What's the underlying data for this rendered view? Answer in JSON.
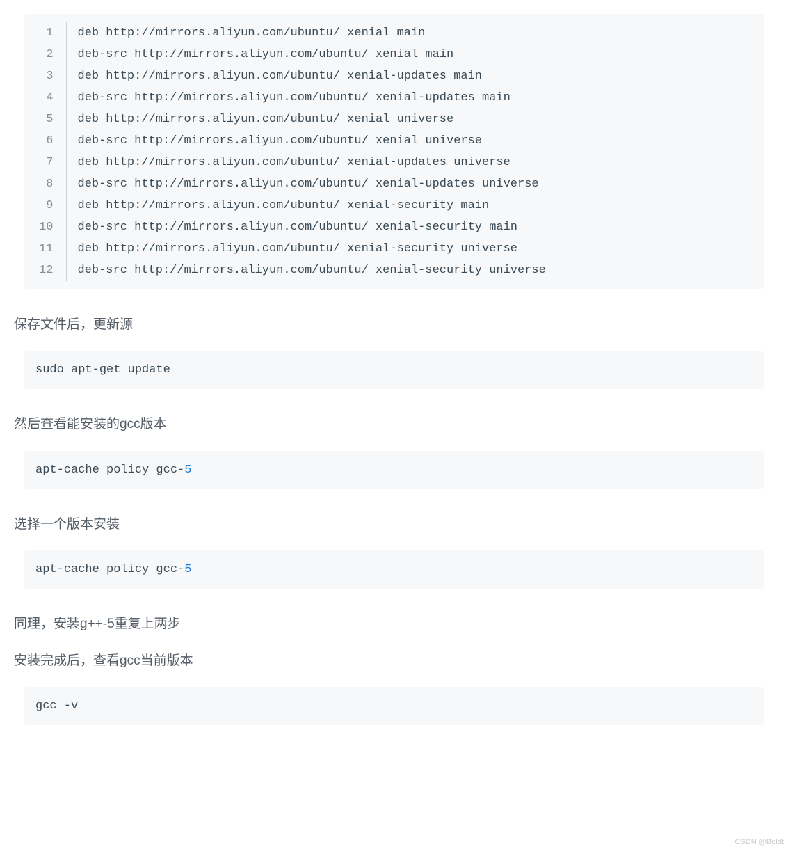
{
  "sourcesList": {
    "lines": [
      "deb http://mirrors.aliyun.com/ubuntu/ xenial main",
      "deb-src http://mirrors.aliyun.com/ubuntu/ xenial main",
      "deb http://mirrors.aliyun.com/ubuntu/ xenial-updates main",
      "deb-src http://mirrors.aliyun.com/ubuntu/ xenial-updates main",
      "deb http://mirrors.aliyun.com/ubuntu/ xenial universe",
      "deb-src http://mirrors.aliyun.com/ubuntu/ xenial universe",
      "deb http://mirrors.aliyun.com/ubuntu/ xenial-updates universe",
      "deb-src http://mirrors.aliyun.com/ubuntu/ xenial-updates universe",
      "deb http://mirrors.aliyun.com/ubuntu/ xenial-security main",
      "deb-src http://mirrors.aliyun.com/ubuntu/ xenial-security main",
      "deb http://mirrors.aliyun.com/ubuntu/ xenial-security universe",
      "deb-src http://mirrors.aliyun.com/ubuntu/ xenial-security universe"
    ]
  },
  "para1": "保存文件后，更新源",
  "cmd1": "sudo apt-get update",
  "para2": "然后查看能安装的gcc版本",
  "cmd2_prefix": "apt-cache policy gcc-",
  "cmd2_num": "5",
  "para3": "选择一个版本安装",
  "cmd3_prefix": "apt-cache policy gcc-",
  "cmd3_num": "5",
  "para4": "同理，安装g++-5重复上两步",
  "para5": "安装完成后，查看gcc当前版本",
  "cmd4": "gcc -v",
  "watermark": "CSDN @Boldt"
}
